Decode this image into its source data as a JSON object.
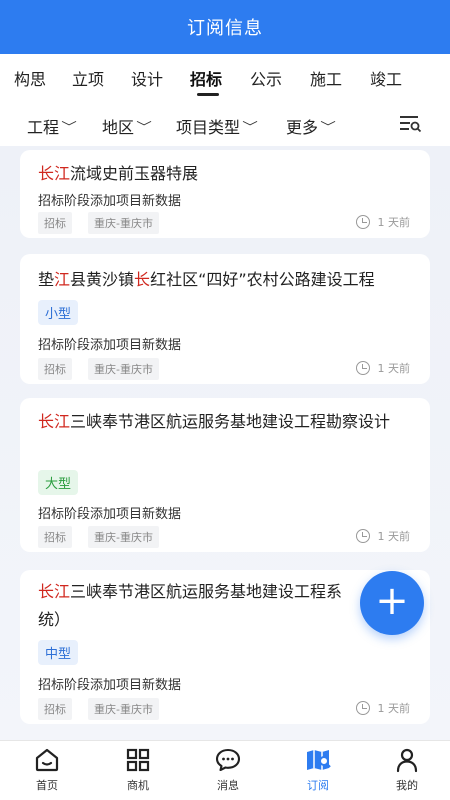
{
  "header": {
    "title": "订阅信息"
  },
  "tabs": [
    {
      "label": "构思"
    },
    {
      "label": "立项"
    },
    {
      "label": "设计"
    },
    {
      "label": "招标",
      "active": true
    },
    {
      "label": "公示"
    },
    {
      "label": "施工"
    },
    {
      "label": "竣工"
    }
  ],
  "filters": [
    {
      "label": "工程"
    },
    {
      "label": "地区"
    },
    {
      "label": "项目类型"
    },
    {
      "label": "更多"
    }
  ],
  "cards": [
    {
      "title_parts": [
        {
          "text": "长江",
          "highlight": true
        },
        {
          "text": "流域史前玉器特展",
          "highlight": false
        }
      ],
      "size": "",
      "stage": "招标阶段添加项目新数据",
      "tag_stage": "招标",
      "tag_region": "重庆-重庆市",
      "time": "1 天前"
    },
    {
      "title_parts": [
        {
          "text": "垫",
          "highlight": false
        },
        {
          "text": "江",
          "highlight": true
        },
        {
          "text": "县黄沙镇",
          "highlight": false
        },
        {
          "text": "长",
          "highlight": true
        },
        {
          "text": "红社区“四好”农村公路建设工程",
          "highlight": false
        }
      ],
      "size": "小型",
      "stage": "招标阶段添加项目新数据",
      "tag_stage": "招标",
      "tag_region": "重庆-重庆市",
      "time": "1 天前"
    },
    {
      "title_parts": [
        {
          "text": "长江",
          "highlight": true
        },
        {
          "text": "三峡奉节港区航运服务基地建设工程勘察设计",
          "highlight": false
        }
      ],
      "size": "大型",
      "stage": "招标阶段添加项目新数据",
      "tag_stage": "招标",
      "tag_region": "重庆-重庆市",
      "time": "1 天前"
    },
    {
      "title_parts": [
        {
          "text": "长江",
          "highlight": true
        },
        {
          "text": "三峡奉节港区航运服务基地建设工程系统）",
          "highlight": false
        }
      ],
      "size": "中型",
      "stage": "招标阶段添加项目新数据",
      "tag_stage": "招标",
      "tag_region": "重庆-重庆市",
      "time": "1 天前"
    }
  ],
  "fab": {
    "icon": "plus-icon",
    "label": "+"
  },
  "bottom_nav": [
    {
      "label": "首页",
      "icon": "home-icon"
    },
    {
      "label": "商机",
      "icon": "grid-icon"
    },
    {
      "label": "消息",
      "icon": "chat-icon"
    },
    {
      "label": "订阅",
      "icon": "map-icon",
      "active": true
    },
    {
      "label": "我的",
      "icon": "user-icon"
    }
  ],
  "colors": {
    "brand": "#2d7cf0",
    "highlight": "#d0281f"
  }
}
